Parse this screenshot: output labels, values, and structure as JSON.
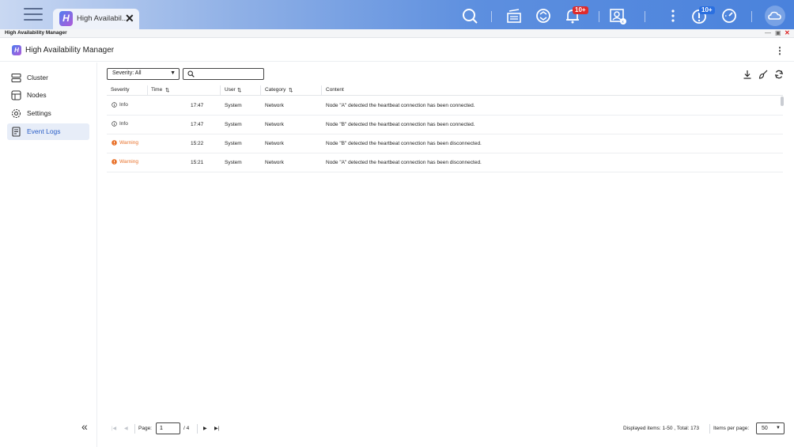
{
  "taskbar": {
    "tab_title": "High Availabil...",
    "logo_letter": "H",
    "notification_badge": "10+",
    "update_badge": "10+",
    "badge_color": "#e02b2b",
    "update_badge_color": "#2a6fe0"
  },
  "window": {
    "title": "High Availability Manager"
  },
  "header": {
    "title": "High Availability Manager",
    "logo_letter": "H"
  },
  "sidebar": {
    "items": [
      {
        "label": "Cluster",
        "icon": "cluster-icon"
      },
      {
        "label": "Nodes",
        "icon": "nodes-icon"
      },
      {
        "label": "Settings",
        "icon": "gear-icon"
      },
      {
        "label": "Event Logs",
        "icon": "event-log-icon",
        "active": true
      }
    ],
    "collapse_glyph": "«"
  },
  "toolbar": {
    "severity_filter": "Severity: All",
    "search_value": ""
  },
  "table": {
    "headers": [
      "Severity",
      "Time",
      "User",
      "Category",
      "Content"
    ],
    "rows": [
      {
        "severity": "Info",
        "level": "info",
        "time": "17:47",
        "user": "System",
        "category": "Network",
        "content": "Node \"A\" detected the heartbeat connection has been connected."
      },
      {
        "severity": "Info",
        "level": "info",
        "time": "17:47",
        "user": "System",
        "category": "Network",
        "content": "Node \"B\" detected the heartbeat connection has been connected."
      },
      {
        "severity": "Warning",
        "level": "warning",
        "time": "15:22",
        "user": "System",
        "category": "Network",
        "content": "Node \"B\" detected the heartbeat connection has been disconnected."
      },
      {
        "severity": "Warning",
        "level": "warning",
        "time": "15:21",
        "user": "System",
        "category": "Network",
        "content": "Node \"A\" detected the heartbeat connection has been disconnected."
      }
    ],
    "warning_color": "#e8712a"
  },
  "footer": {
    "page_label": "Page:",
    "page_value": "1",
    "page_total": "/  4",
    "displayed": "Displayed items: 1-50 , Total: 173",
    "items_per_page_label": "Items per page:",
    "items_per_page_value": "50"
  }
}
